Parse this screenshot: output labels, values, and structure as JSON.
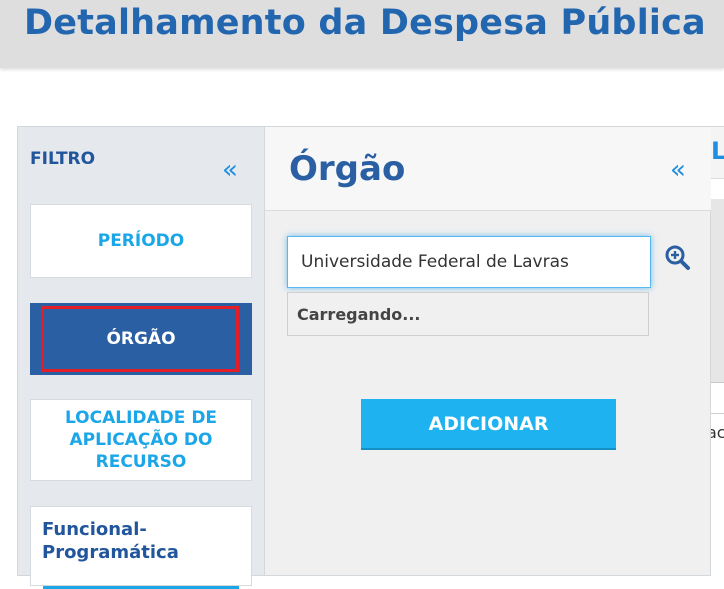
{
  "header": {
    "title": "Detalhamento da Despesa Pública"
  },
  "filter": {
    "title": "FILTRO",
    "collapse_icon": "«",
    "items": [
      {
        "label": "PERÍODO",
        "active": false
      },
      {
        "label": "ÓRGÃO",
        "active": true
      },
      {
        "label": "LOCALIDADE DE APLICAÇÃO DO RECURSO",
        "active": false
      },
      {
        "label": "Funcional-Programática",
        "active": false
      }
    ]
  },
  "orgao": {
    "title": "Órgão",
    "collapse_icon": "«",
    "search_value": "Universidade Federal de Lavras",
    "dropdown_text": "Carregando...",
    "add_label": "ADICIONAR"
  },
  "right_panel": {
    "header_fragment": "L",
    "row_fragment": "ac"
  },
  "colors": {
    "brand_blue": "#2a5fa3",
    "accent_cyan": "#1eb3f0",
    "highlight_red": "#e41e26",
    "header_gray": "#dedede"
  }
}
